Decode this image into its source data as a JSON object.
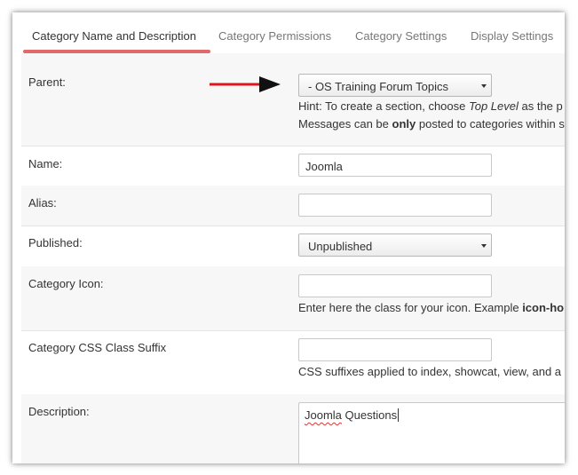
{
  "tabs": [
    {
      "label": "Category Name and Description",
      "active": true
    },
    {
      "label": "Category Permissions",
      "active": false
    },
    {
      "label": "Category Settings",
      "active": false
    },
    {
      "label": "Display Settings",
      "active": false
    }
  ],
  "accent_color": "#e06a6a",
  "arrow_color": "#e0141e",
  "fields": {
    "parent": {
      "label": "Parent:",
      "value": "- OS Training Forum Topics",
      "hint_line1_pre": "Hint: To create a section, choose ",
      "hint_line1_em": "Top Level",
      "hint_line1_post": " as the p",
      "hint_line2_pre": "Messages can be ",
      "hint_line2_strong": "only",
      "hint_line2_post": " posted to categories within s"
    },
    "name": {
      "label": "Name:",
      "value": "Joomla"
    },
    "alias": {
      "label": "Alias:",
      "value": ""
    },
    "published": {
      "label": "Published:",
      "value": "Unpublished"
    },
    "icon": {
      "label": "Category Icon:",
      "value": "",
      "hint_pre": "Enter here the class for your icon. Example ",
      "hint_strong": "icon-ho"
    },
    "css_suffix": {
      "label": "Category CSS Class Suffix",
      "value": "",
      "hint": "CSS suffixes applied to index, showcat, view, and a"
    },
    "description": {
      "label": "Description:",
      "value_word1": "Joomla",
      "value_word2": " Questions"
    }
  }
}
